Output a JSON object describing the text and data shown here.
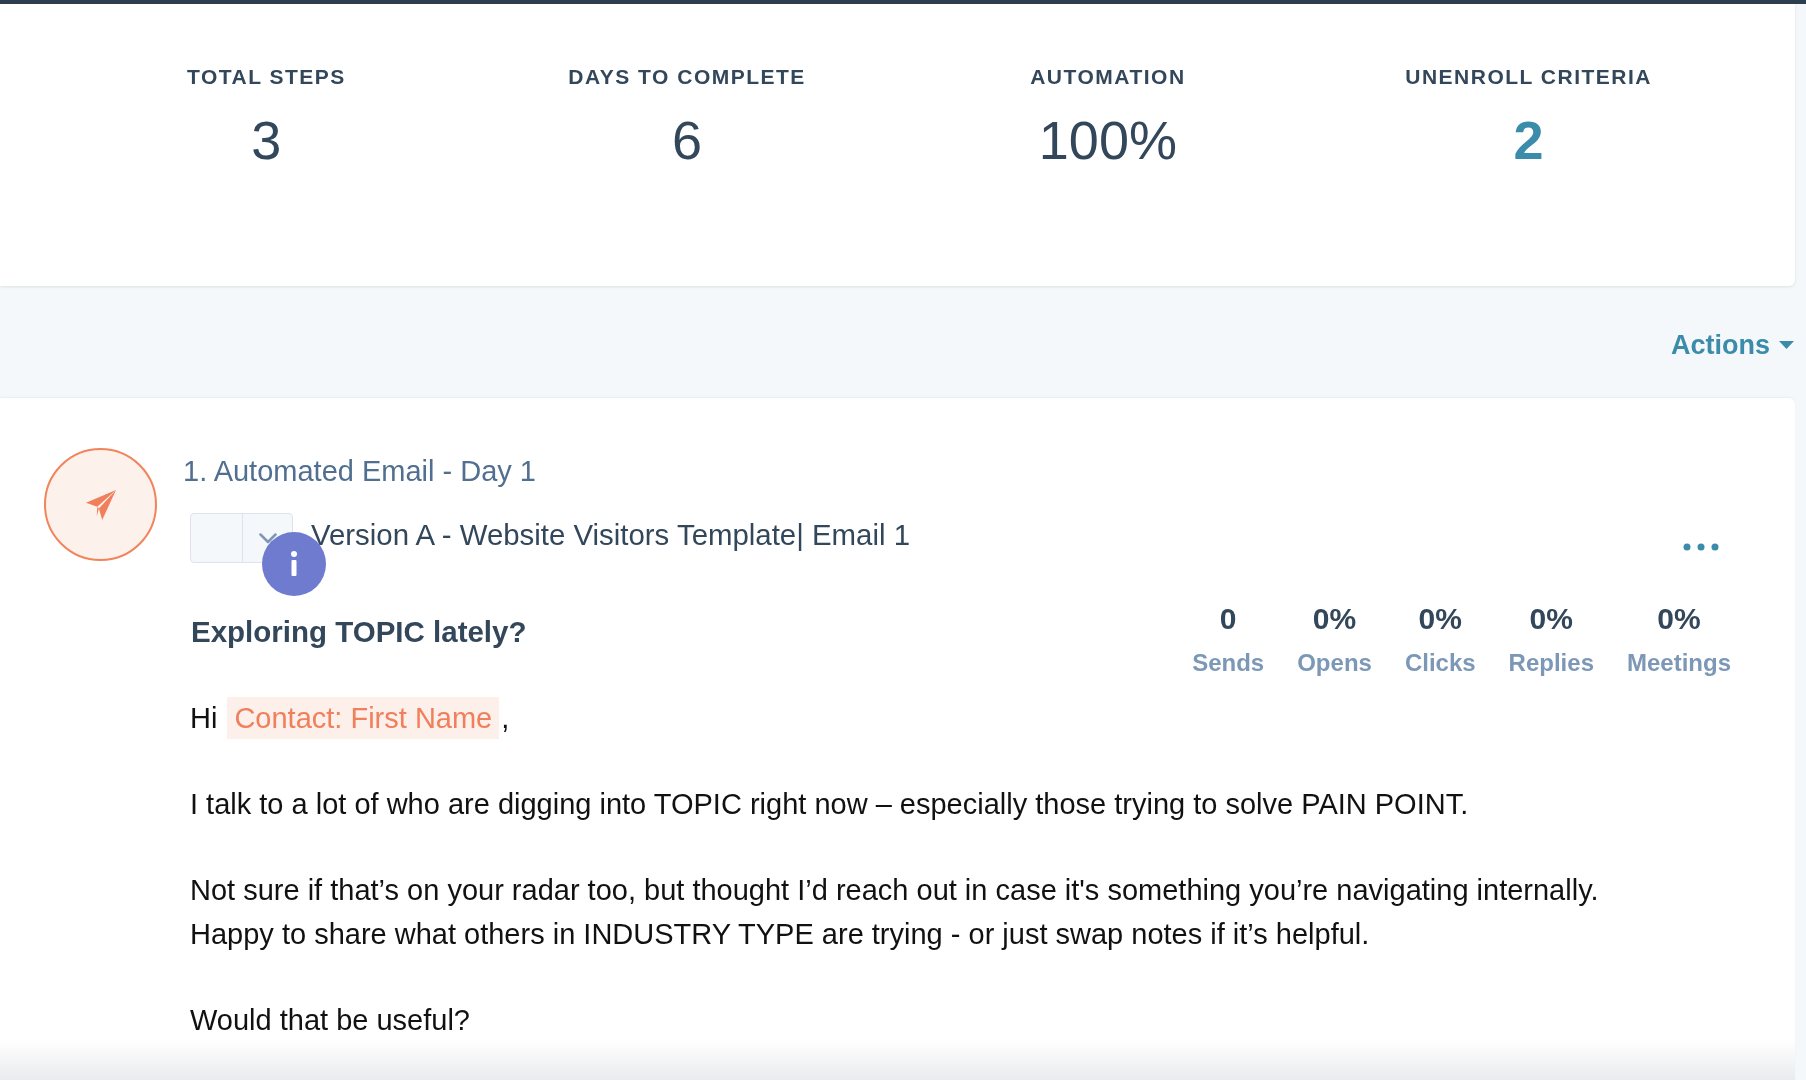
{
  "summary": {
    "stats": [
      {
        "label": "TOTAL STEPS",
        "value": "3",
        "kind": "plain"
      },
      {
        "label": "DAYS TO COMPLETE",
        "value": "6",
        "kind": "plain"
      },
      {
        "label": "AUTOMATION",
        "value": "100%",
        "kind": "plain"
      },
      {
        "label": "UNENROLL CRITERIA",
        "value": "2",
        "kind": "link"
      }
    ]
  },
  "actions_menu": {
    "label": "Actions"
  },
  "step": {
    "title": "1. Automated Email - Day 1",
    "template": "Version A - Website Visitors Template| Email 1",
    "subject": "Exploring TOPIC lately?",
    "metrics": [
      {
        "value": "0",
        "label": "Sends"
      },
      {
        "value": "0%",
        "label": "Opens"
      },
      {
        "value": "0%",
        "label": "Clicks"
      },
      {
        "value": "0%",
        "label": "Replies"
      },
      {
        "value": "0%",
        "label": "Meetings"
      }
    ],
    "body": [
      {
        "kind": "greeting",
        "text": "Hi",
        "token": "Contact: First Name",
        "after": ","
      },
      {
        "kind": "paragraph",
        "lines": [
          "I talk to a lot of who are digging into TOPIC right now – especially those trying to solve PAIN POINT."
        ]
      },
      {
        "kind": "paragraph",
        "lines": [
          "Not sure if that’s on your radar too, but thought I’d reach out in case it's something you’re navigating internally.",
          "Happy to share what others in INDUSTRY TYPE are trying - or just swap notes if it’s helpful."
        ]
      },
      {
        "kind": "paragraph",
        "lines": [
          "Would that be useful?"
        ]
      }
    ]
  }
}
